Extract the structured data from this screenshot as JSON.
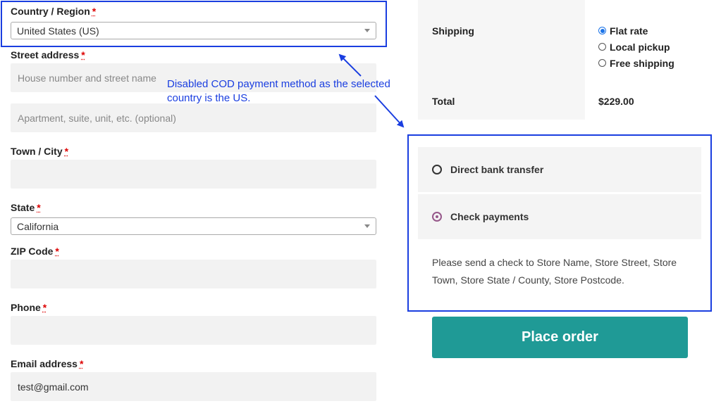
{
  "form": {
    "country_label": "Country / Region",
    "country_value": "United States (US)",
    "street_label": "Street address",
    "street_placeholder": "House number and street name",
    "apartment_placeholder": "Apartment, suite, unit, etc. (optional)",
    "city_label": "Town / City",
    "state_label": "State",
    "state_value": "California",
    "zip_label": "ZIP Code",
    "phone_label": "Phone",
    "email_label": "Email address",
    "email_value": "test@gmail.com",
    "required_mark": "*"
  },
  "annotation": {
    "text_line1": "Disabled COD payment method as the selected",
    "text_line2": "country is the US.",
    "color": "#1a3ee0"
  },
  "summary": {
    "shipping_label": "Shipping",
    "shipping_options": [
      {
        "label": "Flat rate",
        "selected": true
      },
      {
        "label": "Local pickup",
        "selected": false
      },
      {
        "label": "Free shipping",
        "selected": false
      }
    ],
    "total_label": "Total",
    "total_value": "$229.00"
  },
  "payment": {
    "methods": [
      {
        "label": "Direct bank transfer",
        "selected": false
      },
      {
        "label": "Check payments",
        "selected": true
      }
    ],
    "description": "Please send a check to Store Name, Store Street, Store Town, Store State / County, Store Postcode.",
    "place_order_label": "Place order",
    "button_color": "#1f9a96"
  }
}
